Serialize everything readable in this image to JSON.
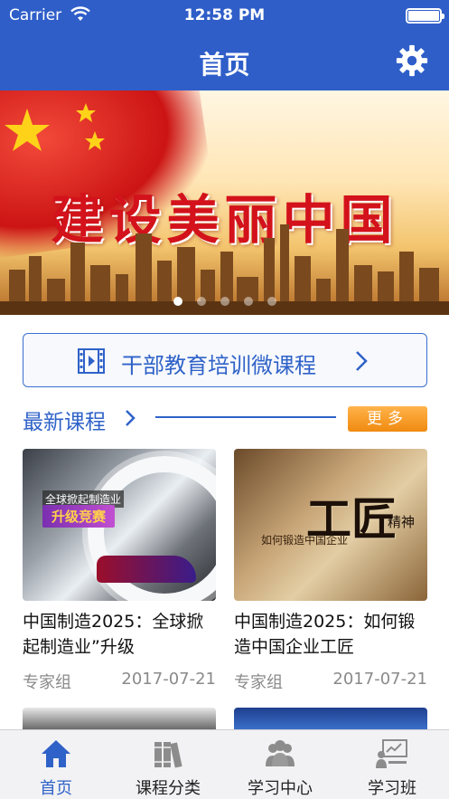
{
  "status_bar": {
    "carrier": "Carrier",
    "time": "12:58 PM"
  },
  "nav": {
    "title": "首页",
    "settings_icon": "gear-icon"
  },
  "banner": {
    "slogan": "建设美丽中国",
    "page_count": 5,
    "active_page": 1
  },
  "course_entry": {
    "label": "干部教育培训微课程",
    "icon": "film-icon"
  },
  "latest": {
    "title": "最新课程",
    "more_label": "更多"
  },
  "courses": [
    {
      "title": "中国制造2025：全球掀起制造业”升级",
      "author": "专家组",
      "date": "2017-07-21",
      "thumb_caption": "全球掀起制造业",
      "thumb_tag": "升级竞赛"
    },
    {
      "title": "中国制造2025：如何锻造中国企业工匠",
      "author": "专家组",
      "date": "2017-07-21",
      "thumb_caption": "工匠",
      "thumb_tag": "精神",
      "thumb_sub": "如何锻造中国企业"
    }
  ],
  "tabs": [
    {
      "label": "首页",
      "icon": "home-icon",
      "active": true
    },
    {
      "label": "课程分类",
      "icon": "books-icon",
      "active": false
    },
    {
      "label": "学习中心",
      "icon": "people-icon",
      "active": false
    },
    {
      "label": "学习班",
      "icon": "classroom-icon",
      "active": false
    }
  ],
  "colors": {
    "primary": "#2f5ec9",
    "accent_link": "#2f62c8",
    "more_button": "#f08a10",
    "slogan": "#d3121b"
  }
}
